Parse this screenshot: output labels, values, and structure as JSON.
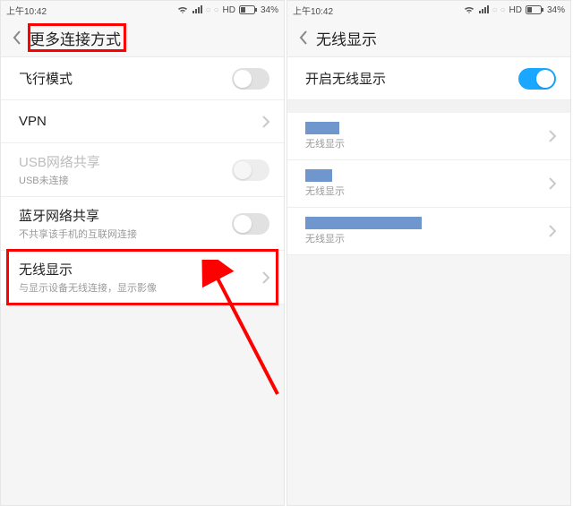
{
  "status": {
    "time": "上午10:42",
    "hd": "HD",
    "battery_pct": "34%"
  },
  "left": {
    "title": "更多连接方式",
    "airplane": {
      "label": "飞行模式"
    },
    "vpn": {
      "label": "VPN"
    },
    "usb": {
      "label": "USB网络共享",
      "sub": "USB未连接"
    },
    "bt": {
      "label": "蓝牙网络共享",
      "sub": "不共享该手机的互联网连接"
    },
    "wd": {
      "label": "无线显示",
      "sub": "与显示设备无线连接，显示影像"
    }
  },
  "right": {
    "title": "无线显示",
    "enable": {
      "label": "开启无线显示"
    },
    "device_sub": "无线显示"
  }
}
